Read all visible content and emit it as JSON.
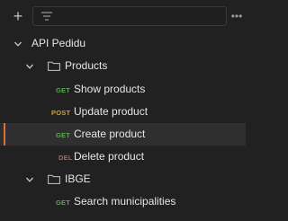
{
  "toolbar": {
    "add_icon": "plus-icon",
    "add_label": "+",
    "filter_icon": "filter-lines-icon",
    "more_label": "•••"
  },
  "tree": {
    "collection": {
      "label": "API Pedidu",
      "chevron": "chevron-down-icon"
    },
    "folders": [
      {
        "label": "Products",
        "chevron": "chevron-down-icon",
        "icon": "folder-icon",
        "requests": [
          {
            "method": "GET",
            "label": "Show products",
            "method_color": "#5aa851"
          },
          {
            "method": "POST",
            "label": "Update product",
            "method_color": "#e0a100"
          },
          {
            "method": "GET",
            "label": "Create product",
            "method_color": "#5aa851",
            "selected": true
          },
          {
            "method": "DEL",
            "label": "Delete product",
            "method_color": "#d9534f"
          }
        ]
      },
      {
        "label": "IBGE",
        "chevron": "chevron-down-icon",
        "icon": "folder-icon",
        "requests": [
          {
            "method": "GET",
            "label": "Search municipalities",
            "method_color": "#5aa851"
          }
        ]
      }
    ]
  },
  "colors": {
    "background": "#212121",
    "selected_row": "#2f2f2f",
    "selection_accent": "#e0703a"
  }
}
